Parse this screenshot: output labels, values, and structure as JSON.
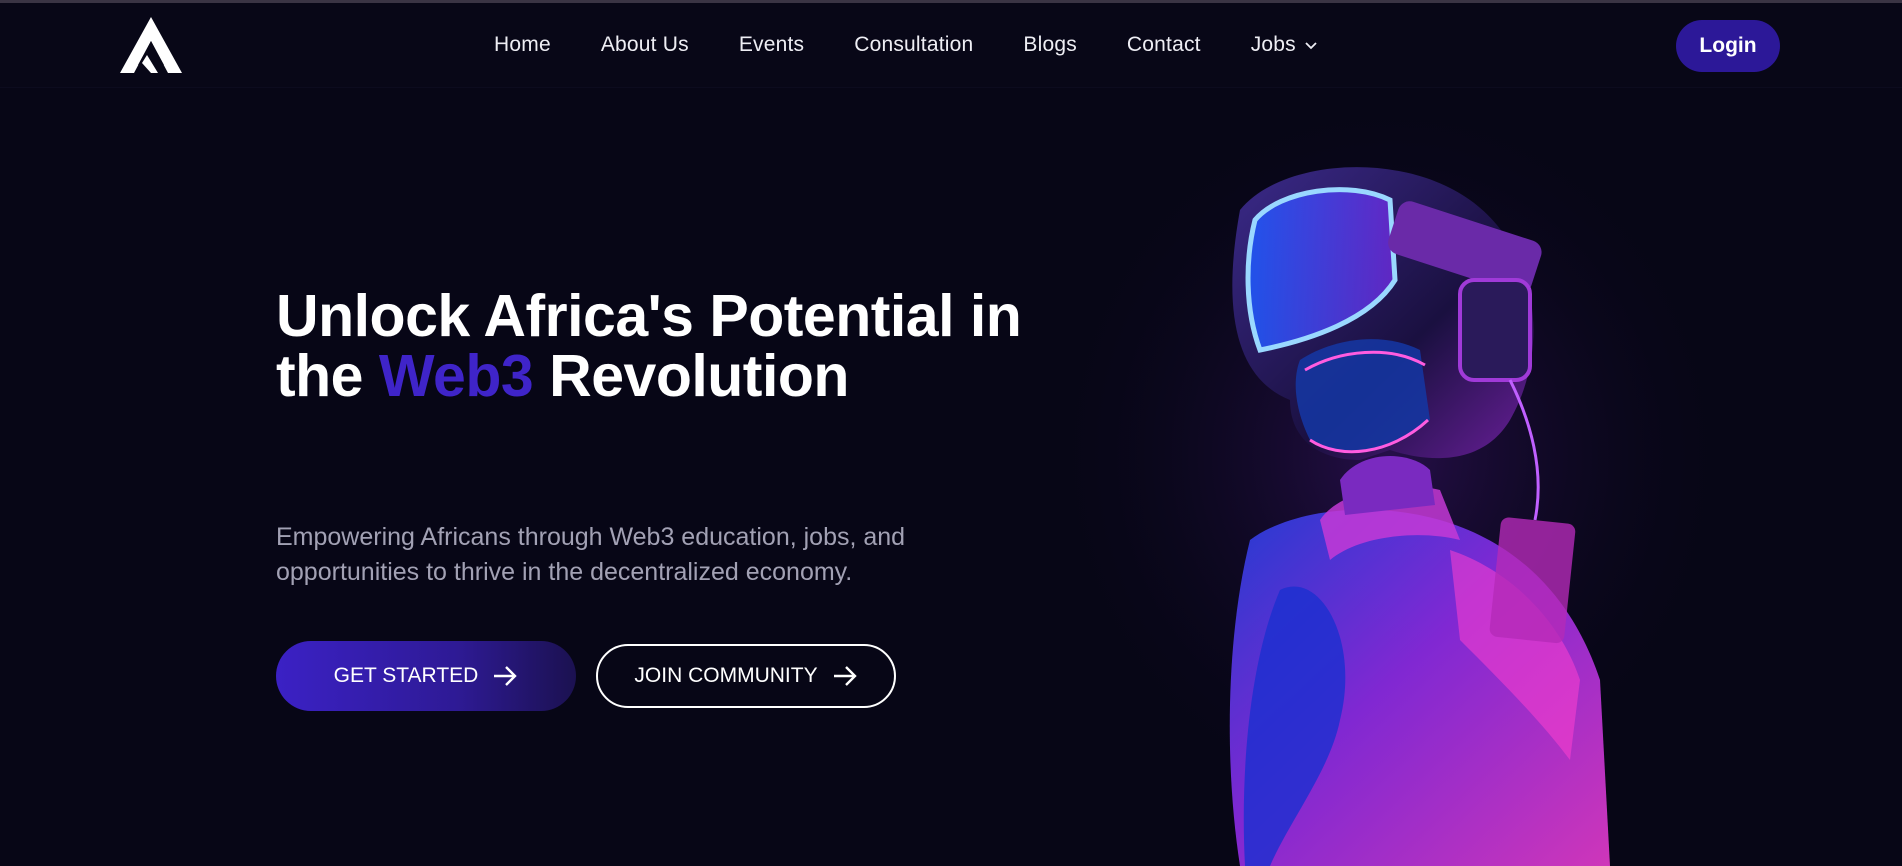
{
  "header": {
    "logo_icon": "triangle-a-logo-icon",
    "nav": [
      {
        "label": "Home"
      },
      {
        "label": "About Us"
      },
      {
        "label": "Events"
      },
      {
        "label": "Consultation"
      },
      {
        "label": "Blogs"
      },
      {
        "label": "Contact"
      },
      {
        "label": "Jobs",
        "icon": "chevron-down-icon"
      }
    ],
    "login_label": "Login"
  },
  "hero": {
    "title_part1": "Unlock Africa's Potential in the ",
    "title_accent": "Web3",
    "title_part2": " Revolution",
    "subtitle": "Empowering Africans through Web3 education, jobs, and opportunities to thrive in the decentralized economy.",
    "primary_button": "GET STARTED",
    "secondary_button": "JOIN COMMUNITY",
    "button_icon": "arrow-right-icon",
    "illustration": "neon-vr-helmet-figure-image"
  },
  "colors": {
    "background": "#070616",
    "accent": "#3f24c9",
    "login": "#2c1898",
    "subtitle": "#a2a1b4"
  }
}
